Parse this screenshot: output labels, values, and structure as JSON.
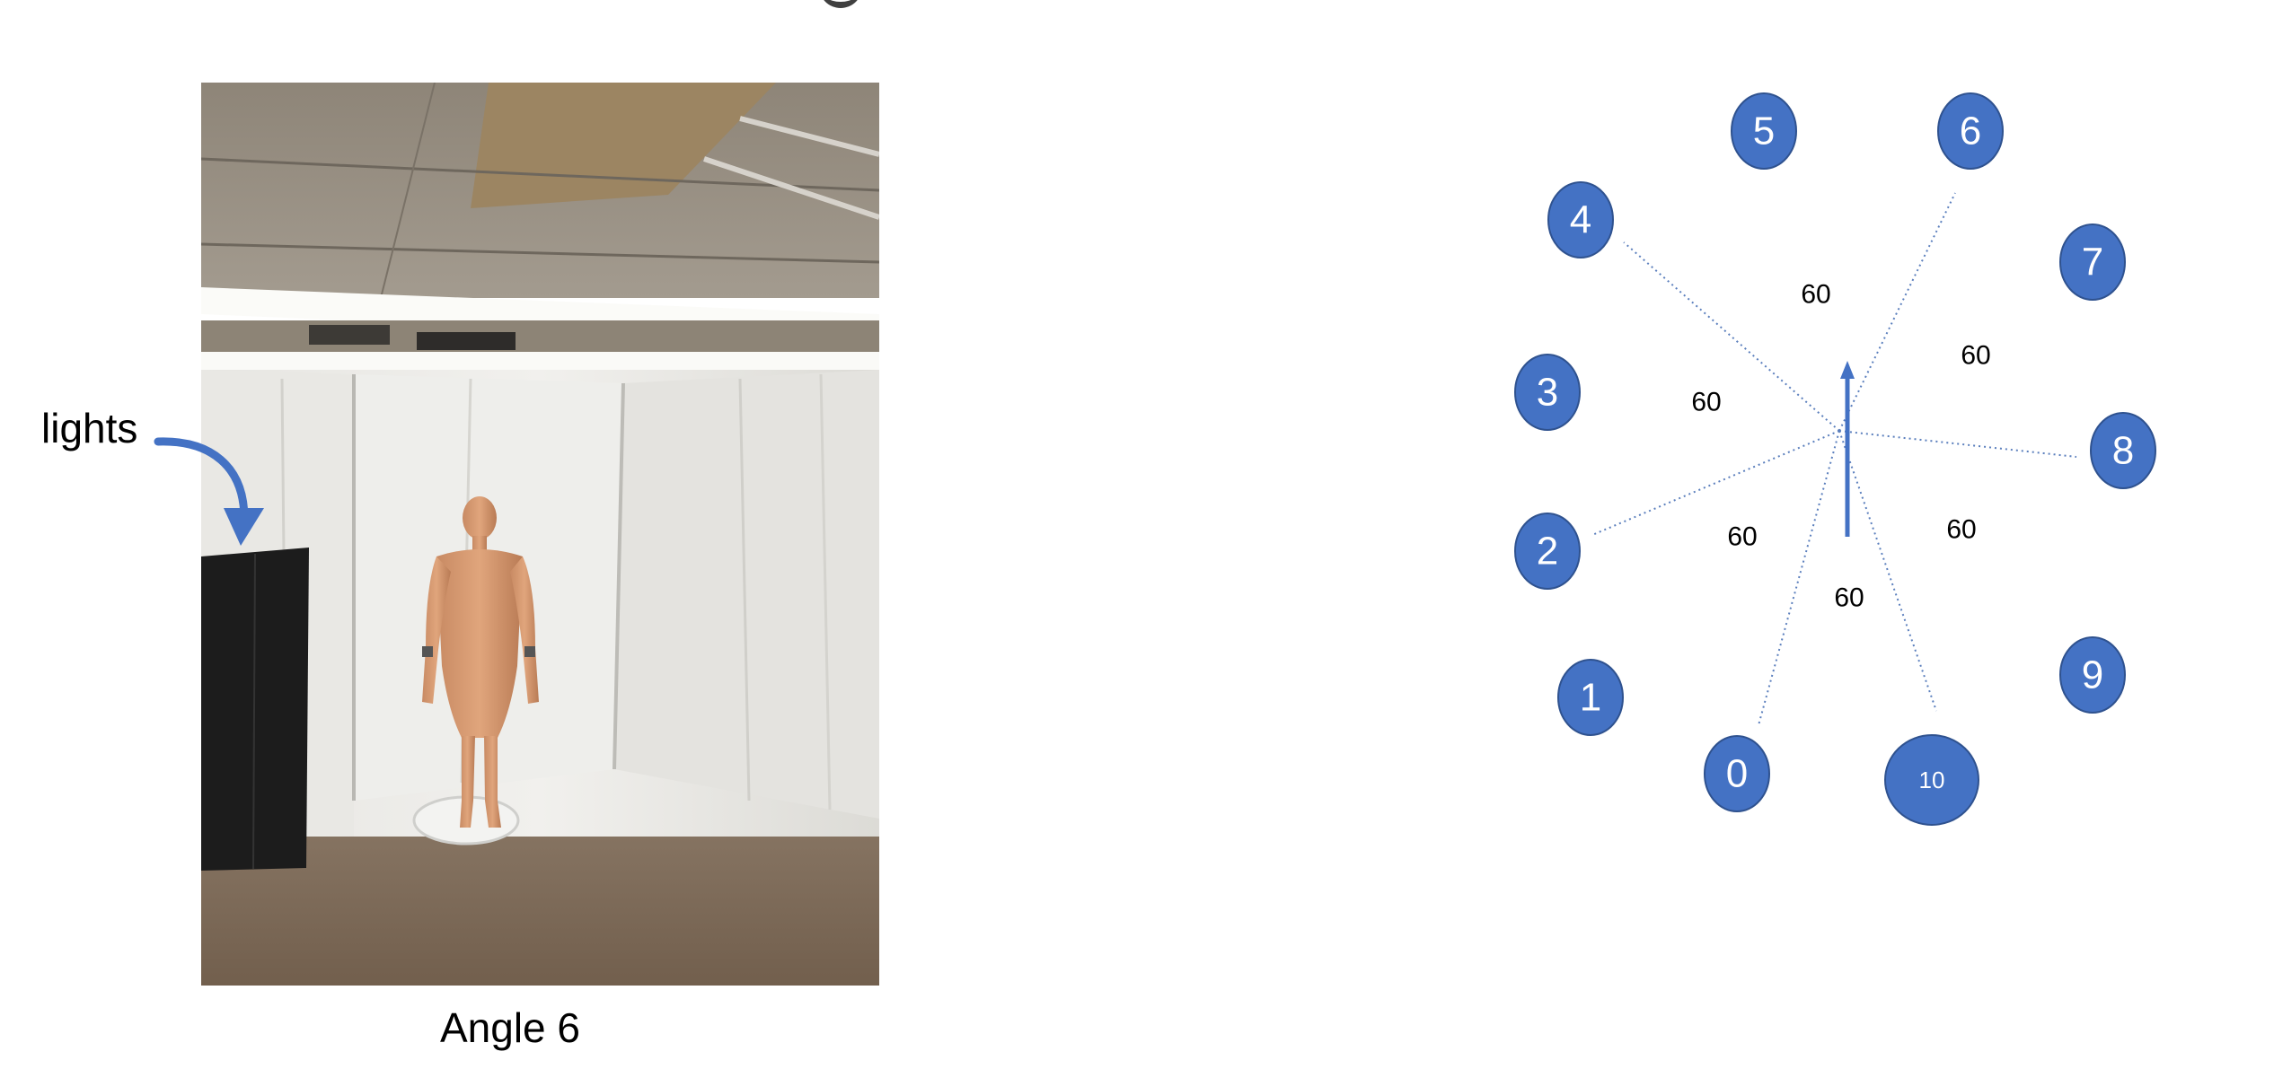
{
  "photo": {
    "caption": "Angle 6",
    "annotation_label": "lights"
  },
  "diagram": {
    "positions": [
      {
        "label": "0"
      },
      {
        "label": "1"
      },
      {
        "label": "2"
      },
      {
        "label": "3"
      },
      {
        "label": "4"
      },
      {
        "label": "5"
      },
      {
        "label": "6"
      },
      {
        "label": "7"
      },
      {
        "label": "8"
      },
      {
        "label": "9"
      },
      {
        "label": "10"
      }
    ],
    "sector_angles": [
      "60",
      "60",
      "60",
      "60",
      "60",
      "60"
    ]
  },
  "colors": {
    "node_fill": "#4472c4",
    "node_stroke": "#2f528f",
    "arrow": "#4472c4",
    "divider": "#5b7fbd"
  }
}
